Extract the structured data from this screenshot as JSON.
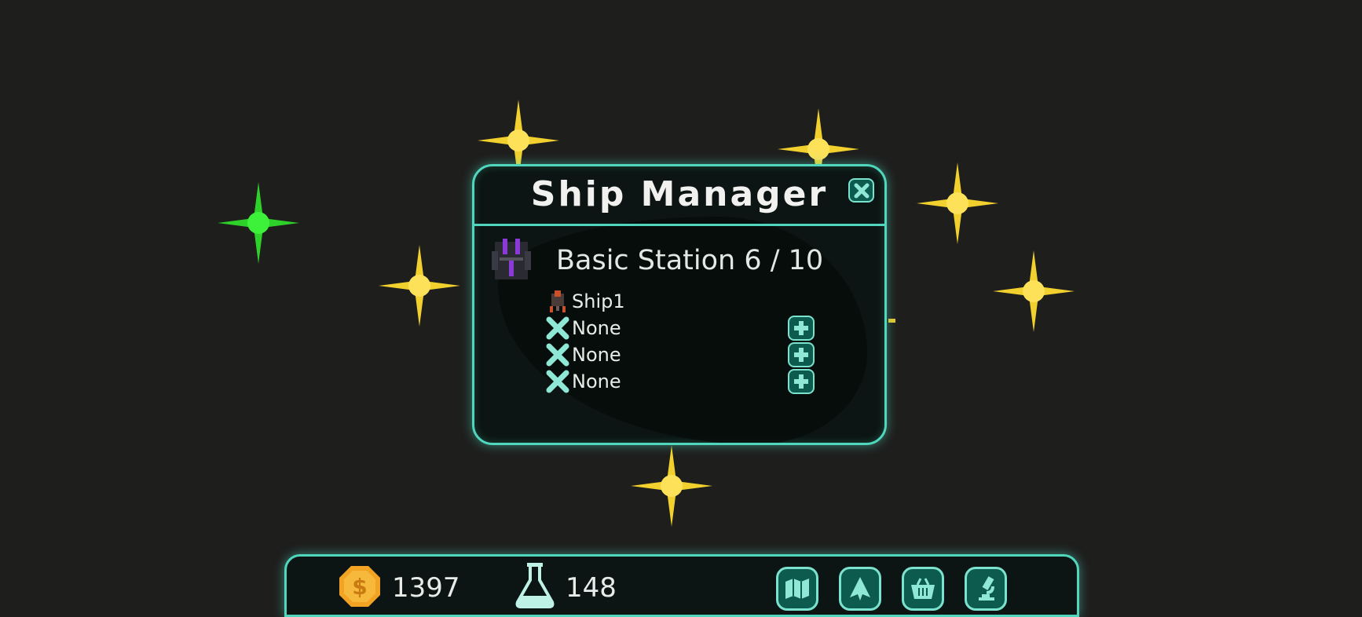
{
  "dialog": {
    "title": "Ship Manager",
    "station_label": "Basic Station 6 / 10",
    "slots": [
      {
        "name": "Ship1",
        "icon": "ship-icon"
      },
      {
        "name": "None",
        "icon": "empty-slot-x-icon"
      },
      {
        "name": "None",
        "icon": "empty-slot-x-icon"
      },
      {
        "name": "None",
        "icon": "empty-slot-x-icon"
      }
    ]
  },
  "resources": {
    "money": "1397",
    "science": "148"
  },
  "nav_icons": [
    "map-icon",
    "ship-nav-icon",
    "shop-basket-icon",
    "research-microscope-icon"
  ],
  "colors": {
    "accent": "#4fd6bd",
    "button_fill": "#0d5a4f",
    "star_yellow": "#f2d12e",
    "star_green": "#2ed12a",
    "coin": "#f2a324"
  }
}
